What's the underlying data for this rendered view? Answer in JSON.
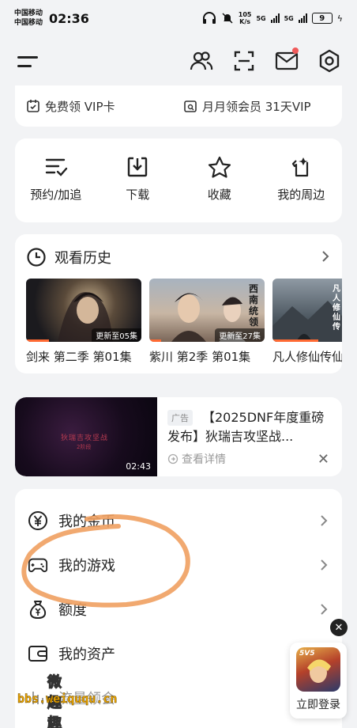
{
  "status_bar": {
    "carrier1": "中国移动",
    "carrier2": "中国移动",
    "time": "02:36",
    "speed_value": "105",
    "speed_unit": "K/s",
    "net1": "5G",
    "net2": "5G",
    "battery": "9"
  },
  "vip": {
    "free_vip_card": "免费领 VIP卡",
    "monthly_vip": "月月领会员 31天VIP"
  },
  "actions": [
    {
      "label": "预约/加追"
    },
    {
      "label": "下载"
    },
    {
      "label": "收藏"
    },
    {
      "label": "我的周边"
    }
  ],
  "history": {
    "title": "观看历史",
    "items": [
      {
        "title": "剑来 第二季 第01集",
        "badge": "更新至05集",
        "progress": 0.2
      },
      {
        "title": "紫川 第2季 第01集",
        "badge": "更新至27集",
        "progress": 0.1
      },
      {
        "title": "凡人修仙传仙",
        "badge": "",
        "progress": 0.4
      }
    ],
    "poster_texts": [
      "西南统领",
      "凡人修仙传"
    ]
  },
  "ad": {
    "tag": "广告",
    "title": "【2025DNF年度重磅发布】狄瑞吉攻坚战...",
    "detail": "查看详情",
    "duration": "02:43",
    "image_text": "狄瑞吉攻坚战",
    "image_subtext": "2阶段"
  },
  "my_list": [
    {
      "label": "我的金币",
      "icon": "yuan-coin-icon"
    },
    {
      "label": "我的游戏",
      "icon": "gamepad-icon"
    },
    {
      "label": "额度",
      "icon": "money-bag-icon"
    },
    {
      "label": "我的资产",
      "icon": "wallet-icon"
    },
    {
      "label": "流量领会",
      "icon": "data-icon"
    }
  ],
  "float_game": {
    "badge": "5V5",
    "label": "立即登录"
  },
  "watermark": {
    "top": "微趣趣",
    "url": "bbs.weiququ.cn"
  },
  "colors": {
    "accent": "#ff6a33",
    "annotation": "#f0a060",
    "notification": "#f05a5a"
  }
}
